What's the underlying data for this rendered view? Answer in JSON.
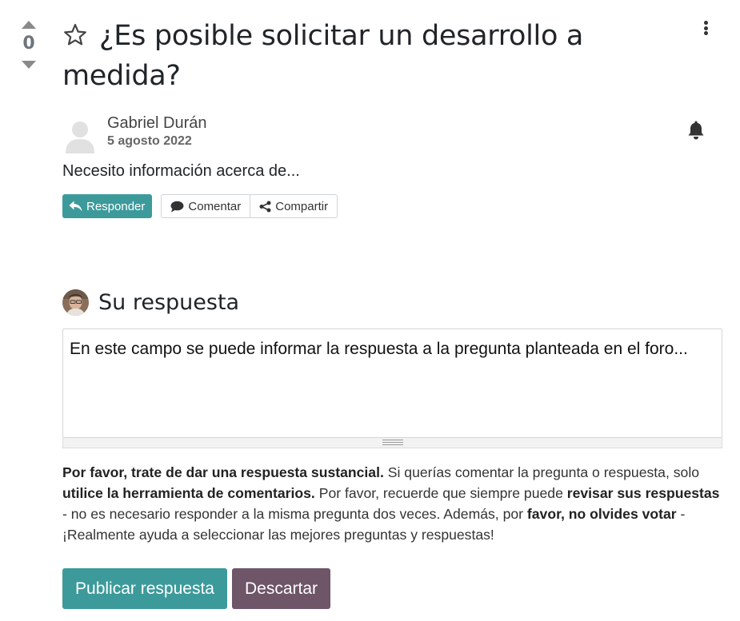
{
  "vote": {
    "count": "0",
    "upvote_icon": "caret-up-icon",
    "downvote_icon": "caret-down-icon"
  },
  "question": {
    "title": "¿Es posible solicitar un desarrollo a medida?",
    "favorite_icon": "star-outline-icon",
    "menu_icon": "kebab-menu-icon",
    "follow_icon": "bell-icon",
    "author": {
      "name": "Gabriel Durán",
      "date": "5 agosto 2022",
      "avatar_icon": "user-placeholder-icon"
    },
    "body": "Necesito información acerca de..."
  },
  "actions": {
    "reply_label": "Responder",
    "reply_icon": "reply-icon",
    "comment_label": "Comentar",
    "comment_icon": "comment-icon",
    "share_label": "Compartir",
    "share_icon": "share-icon"
  },
  "answer": {
    "heading": "Su respuesta",
    "editor_value": "En este campo se puede informar la respuesta a la pregunta planteada en el foro...",
    "help": {
      "b1": "Por favor, trate de dar una respuesta sustancial.",
      "t1": " Si querías comentar la pregunta o respuesta, solo ",
      "b2": "utilice la herramienta de comentarios.",
      "t2": " Por favor, recuerde que siempre puede ",
      "b3": "revisar sus respuestas",
      "t3": " - no es necesario responder a la misma pregunta dos veces. Además, por ",
      "b4": "favor, no olvides votar",
      "t4": " - ¡Realmente ayuda a seleccionar las mejores preguntas y respuestas!"
    },
    "post_label": "Publicar respuesta",
    "discard_label": "Descartar"
  },
  "colors": {
    "primary": "#3d9a9b",
    "secondary": "#6e5568",
    "muted": "#8a8a8a"
  }
}
